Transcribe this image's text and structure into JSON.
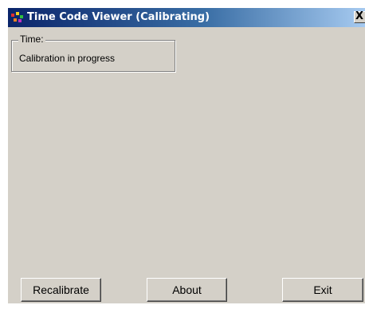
{
  "window": {
    "title": "Time Code Viewer (Calibrating)",
    "close_label": "X",
    "title_gradient_start": "#0a246a",
    "title_gradient_end": "#a6caf0",
    "face_color": "#d4d0c8"
  },
  "time_group": {
    "legend": "Time:",
    "value": "Calibration in progress"
  },
  "buttons": {
    "recalibrate": "Recalibrate",
    "about": "About",
    "exit": "Exit"
  }
}
